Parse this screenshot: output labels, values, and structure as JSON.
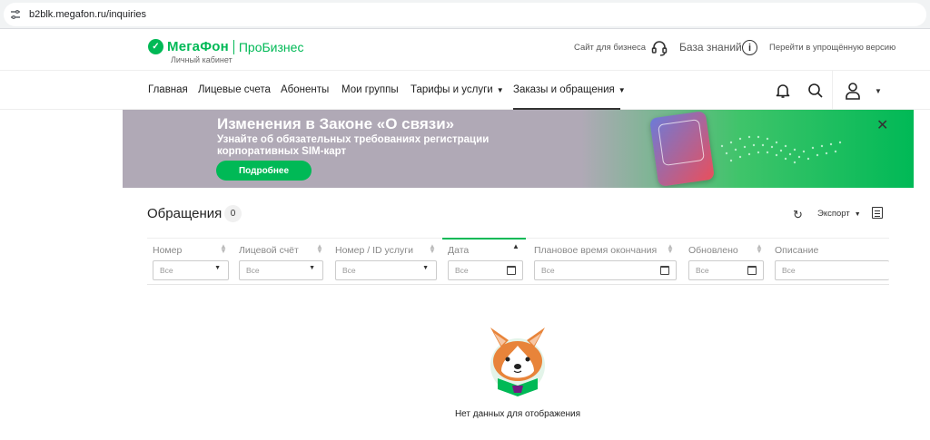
{
  "browser": {
    "url": "b2blk.megafon.ru/inquiries"
  },
  "header": {
    "logo_text": "МегаФон",
    "logo_sub": "ПроБизнес",
    "cabinet_label": "Личный кабинет",
    "business_site": "Сайт для бизнеса",
    "knowledge_base": "База знаний",
    "simple_version": "Перейти в упрощённую версию"
  },
  "nav": {
    "items": [
      {
        "label": "Главная"
      },
      {
        "label": "Лицевые счета"
      },
      {
        "label": "Абоненты"
      },
      {
        "label": "Мои группы"
      },
      {
        "label": "Тарифы и услуги"
      },
      {
        "label": "Заказы и обращения"
      }
    ],
    "active": "Заказы и обращения"
  },
  "banner": {
    "title": "Изменения в Законе «О связи»",
    "subtitle": "Узнайте об обязательных требованиях регистрации корпоративных SIM-карт",
    "button": "Подробнее"
  },
  "section": {
    "title": "Обращения",
    "count": "0",
    "export_label": "Экспорт"
  },
  "table": {
    "columns": [
      {
        "label": "Номер",
        "filter": "Все",
        "type": "select"
      },
      {
        "label": "Лицевой счёт",
        "filter": "Все",
        "type": "select"
      },
      {
        "label": "Номер / ID услуги",
        "filter": "Все",
        "type": "select"
      },
      {
        "label": "Дата",
        "filter": "Все",
        "type": "date",
        "sorted": "asc"
      },
      {
        "label": "Плановое время окончания",
        "filter": "Все",
        "type": "date"
      },
      {
        "label": "Обновлено",
        "filter": "Все",
        "type": "date"
      },
      {
        "label": "Описание",
        "filter": "Все",
        "type": "text"
      }
    ],
    "empty_message": "Нет данных для отображения"
  },
  "colors": {
    "brand_green": "#00b956",
    "brand_purple": "#731982",
    "banner_gray": "#b0a9b6"
  }
}
